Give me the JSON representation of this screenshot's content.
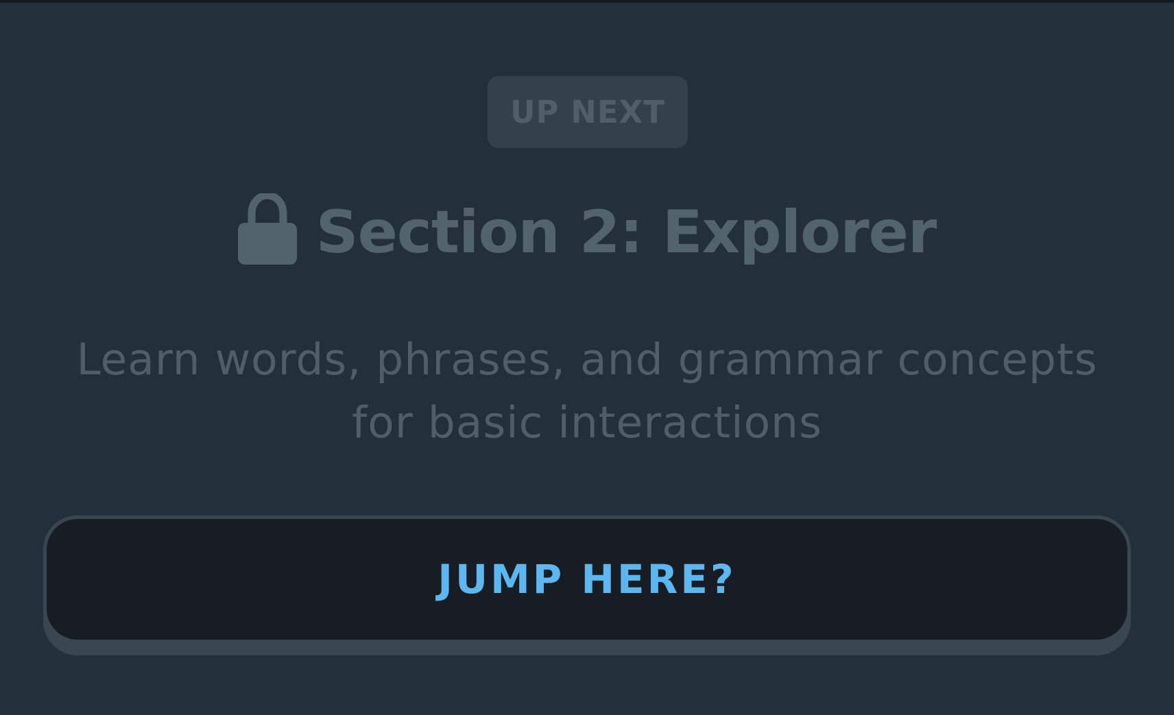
{
  "card": {
    "badge_label": "UP NEXT",
    "lock_icon": "lock-icon",
    "title": "Section 2: Explorer",
    "description": "Learn words, phrases, and grammar concepts for basic interactions",
    "jump_button_label": "JUMP HERE?"
  },
  "colors": {
    "background": "#233039",
    "badge_background": "#34414b",
    "muted_text": "#53636e",
    "button_background": "#171d23",
    "button_border": "#3a4750",
    "accent": "#5cb6f0"
  }
}
